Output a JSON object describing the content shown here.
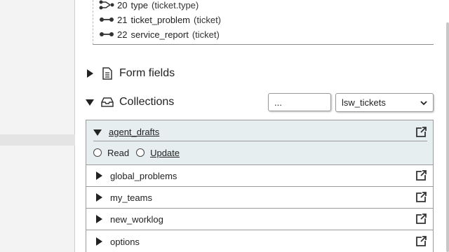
{
  "relations": [
    {
      "num": "20",
      "name": "type",
      "target": "(ticket.type)",
      "icon": "branch-icon"
    },
    {
      "num": "21",
      "name": "ticket_problem",
      "target": "(ticket)",
      "icon": "link-icon"
    },
    {
      "num": "22",
      "name": "service_report",
      "target": "(ticket)",
      "icon": "link-icon"
    }
  ],
  "sections": {
    "form_fields": {
      "label": "Form fields",
      "expanded": false
    },
    "collections": {
      "label": "Collections",
      "expanded": true
    }
  },
  "controls": {
    "filter_value": "...",
    "dataset_selected": "lsw_tickets"
  },
  "collections": {
    "open_item": {
      "name": "agent_drafts",
      "permissions": [
        {
          "label": "Read",
          "link": false
        },
        {
          "label": "Update",
          "link": true
        }
      ]
    },
    "items": [
      "global_problems",
      "my_teams",
      "new_worklog",
      "options"
    ]
  },
  "colors": {
    "open_bg": "#e6eef0",
    "border": "#9a9a9a"
  }
}
